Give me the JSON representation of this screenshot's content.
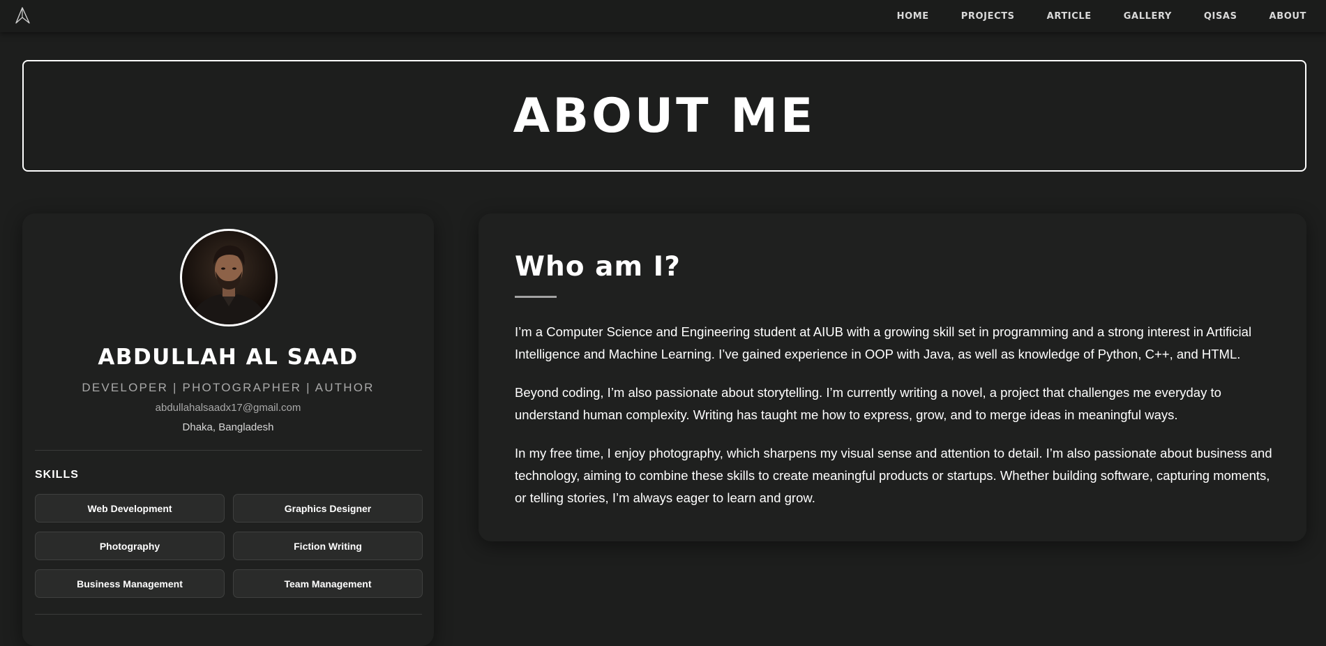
{
  "nav": {
    "logo_icon": "paper-plane-logo-icon",
    "links": [
      "HOME",
      "PROJECTS",
      "ARTICLE",
      "GALLERY",
      "QISAS",
      "ABOUT"
    ]
  },
  "hero": {
    "title": "ABOUT ME"
  },
  "profile": {
    "avatar_icon": "profile-photo",
    "name": "ABDULLAH AL SAAD",
    "role": "DEVELOPER | PHOTOGRAPHER | AUTHOR",
    "email": "abdullahalsaadx17@gmail.com",
    "location": "Dhaka, Bangladesh",
    "skills_heading": "SKILLS",
    "skills": [
      "Web Development",
      "Graphics Designer",
      "Photography",
      "Fiction Writing",
      "Business Management",
      "Team Management"
    ]
  },
  "about": {
    "title": "Who am I?",
    "paragraphs": [
      "I’m a Computer Science and Engineering student at AIUB with a growing skill set in programming and a strong interest in Artificial Intelligence and Machine Learning. I’ve gained experience in OOP with Java, as well as knowledge of Python, C++, and HTML.",
      "Beyond coding, I’m also passionate about storytelling. I’m currently writing a novel, a project that challenges me everyday to understand human complexity. Writing has taught me how to express, grow, and to merge ideas in meaningful ways.",
      "In my free time, I enjoy photography, which sharpens my visual sense and attention to detail. I’m also passionate about business and technology, aiming to combine these skills to create meaningful products or startups. Whether building software, capturing moments, or telling stories, I’m always eager to learn and grow."
    ]
  },
  "colors": {
    "background": "#1d1e1d",
    "card": "#1f201f",
    "skill_chip": "#2a2b2a",
    "text": "#ffffff",
    "muted_text": "#a9a9a9"
  }
}
